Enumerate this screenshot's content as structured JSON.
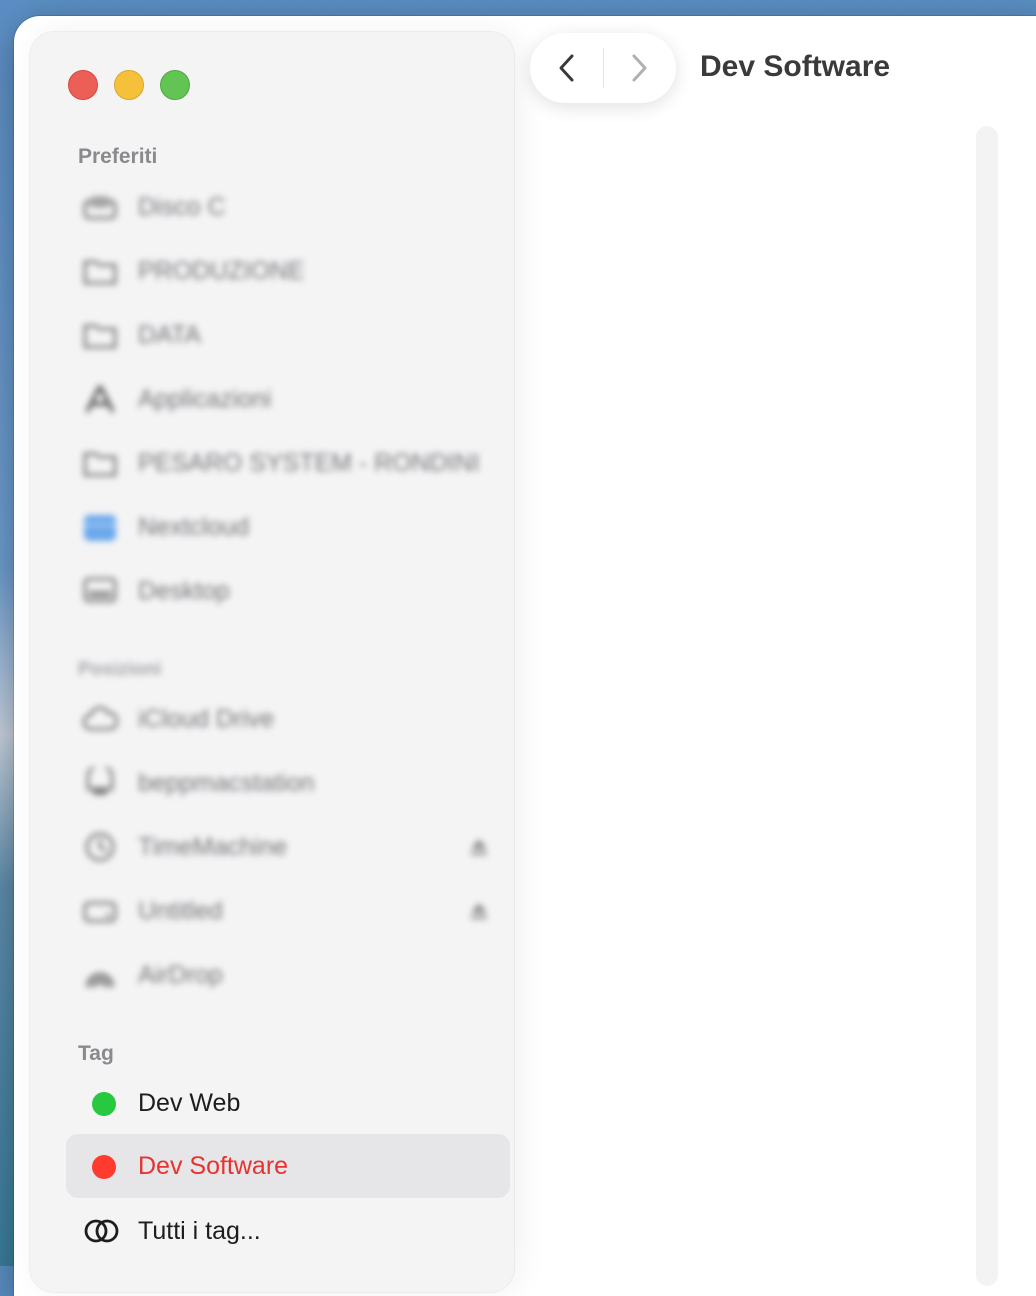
{
  "window": {
    "title": "Dev Software"
  },
  "sidebar": {
    "favorites_header": "Preferiti",
    "favorites": [
      {
        "label": "Disco C",
        "icon": "drive-icon"
      },
      {
        "label": "PRODUZIONE",
        "icon": "folder-icon"
      },
      {
        "label": "DATA",
        "icon": "folder-icon"
      },
      {
        "label": "Applicazioni",
        "icon": "applications-icon"
      },
      {
        "label": "PESARO SYSTEM - RONDINI",
        "icon": "folder-icon"
      },
      {
        "label": "Nextcloud",
        "icon": "nextcloud-folder-icon"
      },
      {
        "label": "Desktop",
        "icon": "desktop-icon"
      }
    ],
    "locations_header": "Posizioni",
    "locations": [
      {
        "label": "iCloud Drive",
        "icon": "cloud-icon"
      },
      {
        "label": "beppmacstation",
        "icon": "computer-icon"
      },
      {
        "label": "TimeMachine",
        "icon": "time-machine-icon"
      },
      {
        "label": "Untitled",
        "icon": "disk-icon"
      },
      {
        "label": "AirDrop",
        "icon": "airdrop-icon"
      }
    ],
    "tags_header": "Tag",
    "tags": [
      {
        "label": "Dev Web",
        "color": "#28c840"
      },
      {
        "label": "Dev Software",
        "color": "#ff3b30"
      },
      {
        "label": "Tutti i tag...",
        "icon": "all-tags-icon"
      }
    ]
  },
  "colors": {
    "accent_red": "#e8322f",
    "sidebar_bg": "#f4f4f5",
    "selection_bg": "#e6e6e8"
  }
}
